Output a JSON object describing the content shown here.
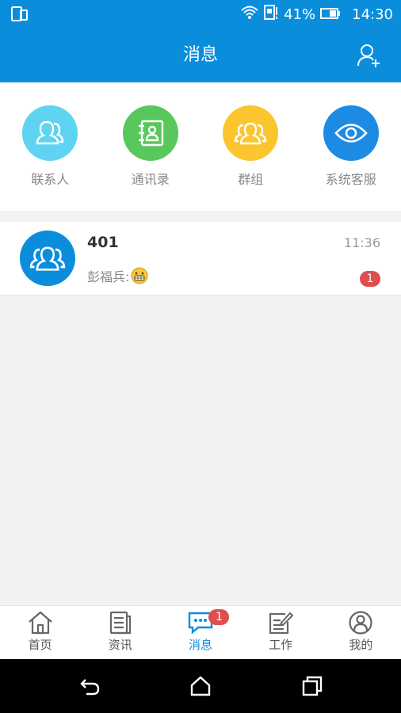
{
  "status_bar": {
    "battery": "41%",
    "time": "14:30"
  },
  "header": {
    "title": "消息"
  },
  "shortcuts": [
    {
      "label": "联系人",
      "color": "#5ed4f2",
      "icon": "contacts-icon"
    },
    {
      "label": "通讯录",
      "color": "#58c75c",
      "icon": "address-book-icon"
    },
    {
      "label": "群组",
      "color": "#fbc52e",
      "icon": "group-icon"
    },
    {
      "label": "系统客服",
      "color": "#1d8be4",
      "icon": "eye-icon"
    }
  ],
  "conversations": [
    {
      "name": "401",
      "time": "11:36",
      "preview": "彭福兵:",
      "unread": "1"
    }
  ],
  "tabs": [
    {
      "label": "首页",
      "icon": "home-icon"
    },
    {
      "label": "资讯",
      "icon": "news-icon"
    },
    {
      "label": "消息",
      "icon": "message-icon",
      "badge": "1",
      "active": true
    },
    {
      "label": "工作",
      "icon": "work-icon"
    },
    {
      "label": "我的",
      "icon": "profile-icon"
    }
  ],
  "colors": {
    "primary": "#0a8edc",
    "badge": "#de4e4e"
  }
}
